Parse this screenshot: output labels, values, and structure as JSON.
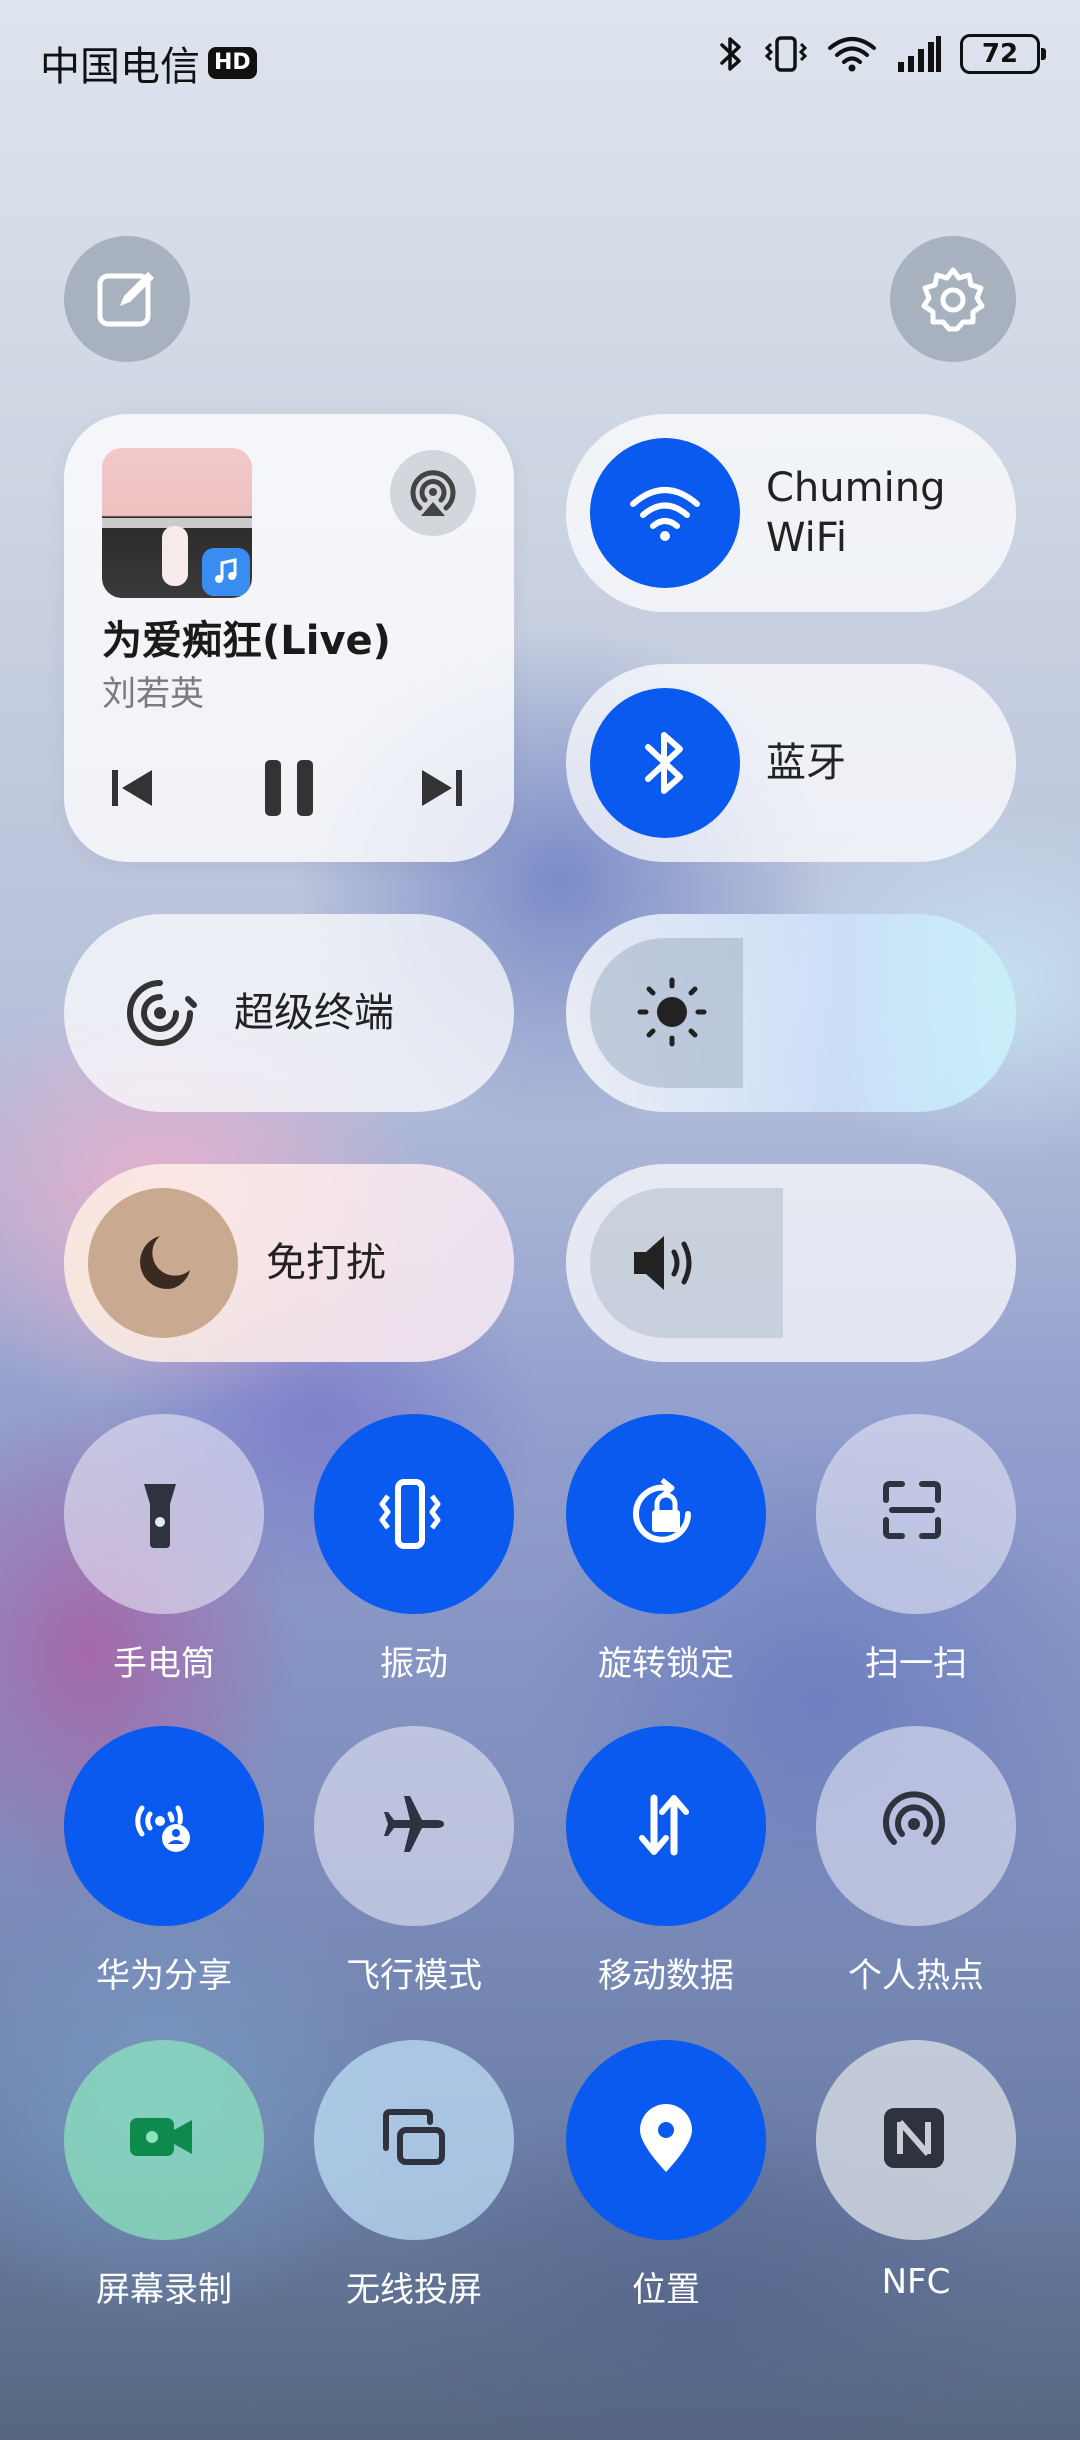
{
  "status_bar": {
    "carrier": "中国电信",
    "network_badge": "HD",
    "battery": "72",
    "icons": [
      "bluetooth-icon",
      "vibrate-icon",
      "wifi-icon",
      "signal-icon"
    ]
  },
  "top": {
    "edit_icon": "edit-icon",
    "settings_icon": "gear-icon"
  },
  "media": {
    "title": "为爱痴狂(Live)",
    "artist": "刘若英",
    "cast_icon": "audio-cast-icon",
    "controls": [
      "previous-icon",
      "pause-icon",
      "next-icon"
    ]
  },
  "wifi": {
    "label_line1": "Chuming",
    "label_line2": "WiFi",
    "active": true
  },
  "bluetooth": {
    "label": "蓝牙",
    "active": true
  },
  "super_device": {
    "label": "超级终端"
  },
  "brightness": {
    "level": 0.38
  },
  "dnd": {
    "label": "免打扰"
  },
  "volume": {
    "level": 0.48
  },
  "tiles": [
    {
      "label": "手电筒",
      "icon": "flashlight-icon",
      "active": false
    },
    {
      "label": "振动",
      "icon": "vibrate-icon",
      "active": true
    },
    {
      "label": "旋转锁定",
      "icon": "rotation-lock-icon",
      "active": true
    },
    {
      "label": "扫一扫",
      "icon": "scan-icon",
      "active": false
    },
    {
      "label": "华为分享",
      "icon": "huawei-share-icon",
      "active": true
    },
    {
      "label": "飞行模式",
      "icon": "airplane-icon",
      "active": false
    },
    {
      "label": "移动数据",
      "icon": "mobile-data-icon",
      "active": true
    },
    {
      "label": "个人热点",
      "icon": "hotspot-icon",
      "active": false
    },
    {
      "label": "屏幕录制",
      "icon": "screen-record-icon",
      "active": false
    },
    {
      "label": "无线投屏",
      "icon": "wireless-projection-icon",
      "active": false
    },
    {
      "label": "位置",
      "icon": "location-icon",
      "active": true
    },
    {
      "label": "NFC",
      "icon": "nfc-icon",
      "active": false
    }
  ],
  "colors": {
    "accent": "#0a5aef"
  }
}
